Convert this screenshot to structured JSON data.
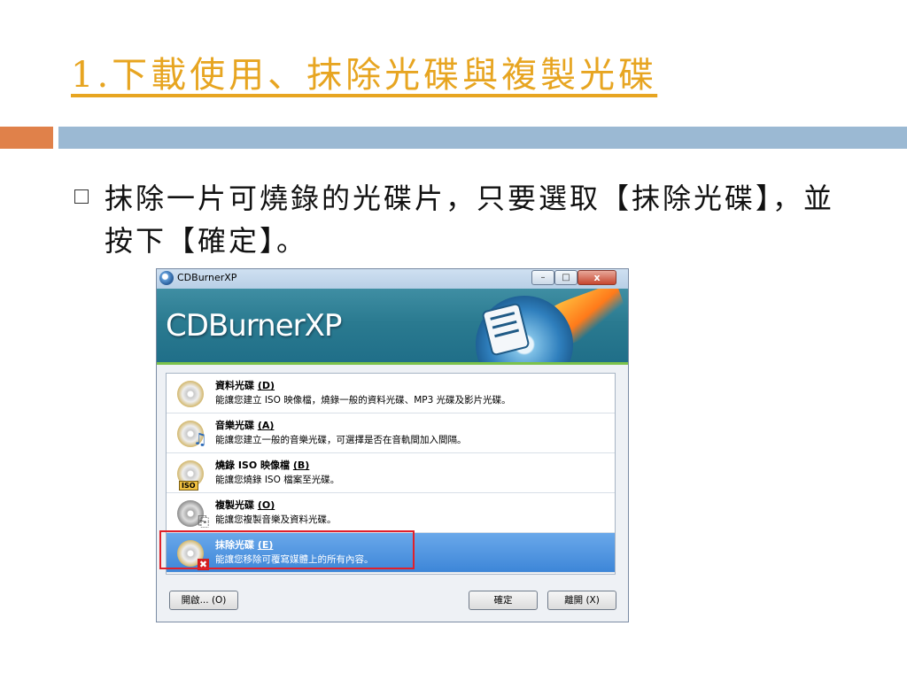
{
  "slide": {
    "title": "1.下載使用、抹除光碟與複製光碟",
    "bullet": "抹除一片可燒錄的光碟片，只要選取【抹除光碟】，並按下【確定】。"
  },
  "window": {
    "title": "CDBurnerXP",
    "brand": "CDBurnerXP",
    "controls": {
      "min": "–",
      "max": "□",
      "close": "x"
    },
    "items": [
      {
        "title": "資料光碟",
        "key": "(D)",
        "desc": "能讓您建立 ISO 映像檔，燒錄一般的資料光碟、MP3 光碟及影片光碟。",
        "icon": "data-disc-icon"
      },
      {
        "title": "音樂光碟",
        "key": "(A)",
        "desc": "能讓您建立一般的音樂光碟，可選擇是否在音軌間加入間隔。",
        "icon": "music-disc-icon"
      },
      {
        "title": "燒錄 ISO 映像檔",
        "key": "(B)",
        "desc": "能讓您燒錄 ISO 檔案至光碟。",
        "icon": "iso-disc-icon"
      },
      {
        "title": "複製光碟",
        "key": "(O)",
        "desc": "能讓您複製音樂及資料光碟。",
        "icon": "copy-disc-icon"
      },
      {
        "title": "抹除光碟",
        "key": "(E)",
        "desc": "能讓您移除可覆寫媒體上的所有內容。",
        "icon": "erase-disc-icon",
        "selected": true
      }
    ],
    "buttons": {
      "open": "開啟... (O)",
      "ok": "確定",
      "close": "離開 (X)"
    }
  },
  "colors": {
    "title": "#e7a521",
    "accent_orange": "#e0814a",
    "accent_blue": "#9bb9d3",
    "highlight": "#e0202a"
  }
}
